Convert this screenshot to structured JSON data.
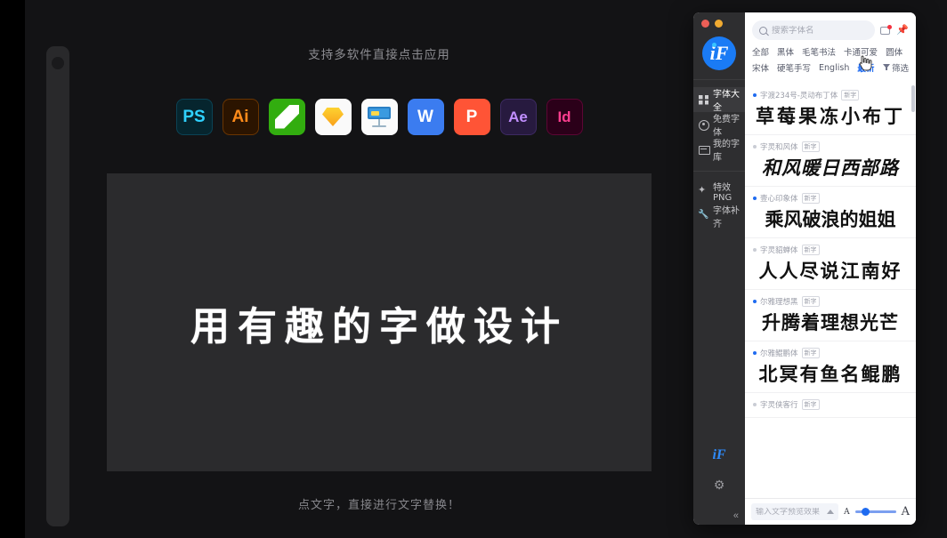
{
  "stage": {
    "caption_top": "支持多软件直接点击应用",
    "caption_bottom": "点文字，直接进行文字替换！",
    "canvas_text": "用有趣的字做设计",
    "apps": [
      {
        "name": "photoshop",
        "label": "PS",
        "style": "ps"
      },
      {
        "name": "illustrator",
        "label": "Ai",
        "style": "ai"
      },
      {
        "name": "keynote-green",
        "label": "",
        "style": "keynote-g"
      },
      {
        "name": "sketch",
        "label": "",
        "style": "sketch"
      },
      {
        "name": "keynote",
        "label": "",
        "style": "keynote"
      },
      {
        "name": "word",
        "label": "W",
        "style": "word"
      },
      {
        "name": "powerpoint",
        "label": "P",
        "style": "ppt"
      },
      {
        "name": "after-effects",
        "label": "Ae",
        "style": "ae"
      },
      {
        "name": "indesign",
        "label": "Id",
        "style": "id"
      }
    ]
  },
  "app": {
    "brand_text": "iF",
    "mini_logo": "iF",
    "collapse_label": "«",
    "search": {
      "placeholder": "搜索字体名",
      "value": ""
    },
    "sidebar": {
      "items": [
        {
          "label": "字体大全",
          "icon": "grid-icon",
          "active": true
        },
        {
          "label": "免费字体",
          "icon": "circle-icon",
          "active": false
        },
        {
          "label": "我的字库",
          "icon": "book-icon",
          "active": false
        },
        {
          "label": "特效PNG",
          "icon": "sparkle-icon",
          "active": false
        },
        {
          "label": "字体补齐",
          "icon": "wrench-icon",
          "active": false
        }
      ]
    },
    "tags": {
      "row1": [
        "全部",
        "黑体",
        "毛笔书法",
        "卡通可爱",
        "圆体"
      ],
      "row2": [
        "宋体",
        "硬笔手写",
        "English"
      ],
      "active": "最新",
      "filter": "筛选"
    },
    "fonts": [
      {
        "name": "字渡234号-灵动布丁体",
        "badge": "新字",
        "preview": "草莓果冻小布丁",
        "dot": "#1f6bf0",
        "style": "fp-round"
      },
      {
        "name": "字灵和风体",
        "badge": "新字",
        "preview": "和风暖日西部路",
        "dot": "#c9ccd4",
        "style": "fp-brush"
      },
      {
        "name": "壹心印象体",
        "badge": "新字",
        "preview": "乘风破浪的姐姐",
        "dot": "#1f6bf0",
        "style": "fp-heavy"
      },
      {
        "name": "字灵貂蝉体",
        "badge": "新字",
        "preview": "人人尽说江南好",
        "dot": "#c9ccd4",
        "style": "fp-serif"
      },
      {
        "name": "尔雅理想黑",
        "badge": "新字",
        "preview": "升腾着理想光芒",
        "dot": "#1f6bf0",
        "style": "fp-black"
      },
      {
        "name": "尔雅鲲鹏体",
        "badge": "新字",
        "preview": "北冥有鱼名鲲鹏",
        "dot": "#1f6bf0",
        "style": "fp-song"
      },
      {
        "name": "字灵侠客行",
        "badge": "新字",
        "preview": "",
        "dot": "#c9ccd4",
        "style": "fp-round"
      }
    ],
    "bottom": {
      "preview_placeholder": "输入文字预览效果",
      "preview_value": "",
      "size_small_label": "A",
      "size_large_label": "A",
      "size_value": 30
    }
  },
  "colors": {
    "accent": "#1f6bf0",
    "window_red": "#ec5f57",
    "window_yellow": "#f1ab31",
    "canvas_bg": "#2b2b2d",
    "app_bg": "#131315"
  }
}
